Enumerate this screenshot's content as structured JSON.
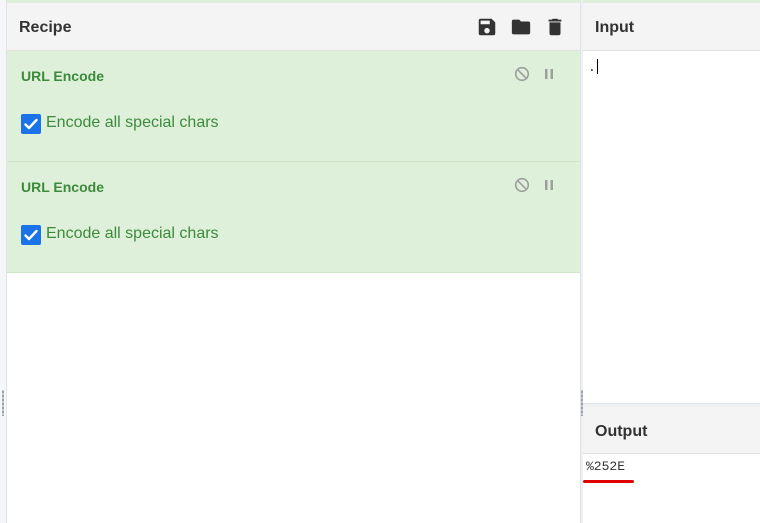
{
  "recipe": {
    "title": "Recipe",
    "icons": [
      "save-icon",
      "folder-icon",
      "trash-icon"
    ],
    "operations": [
      {
        "name": "URL Encode",
        "checkbox_label": "Encode all special chars",
        "checked": true
      },
      {
        "name": "URL Encode",
        "checkbox_label": "Encode all special chars",
        "checked": true
      }
    ]
  },
  "input": {
    "title": "Input",
    "value": "."
  },
  "output": {
    "title": "Output",
    "value": "%252E"
  },
  "colors": {
    "operation_bg": "#dff0da",
    "operation_text": "#3c8a3c",
    "checkbox": "#1a73e8",
    "annotation": "#e00000"
  }
}
